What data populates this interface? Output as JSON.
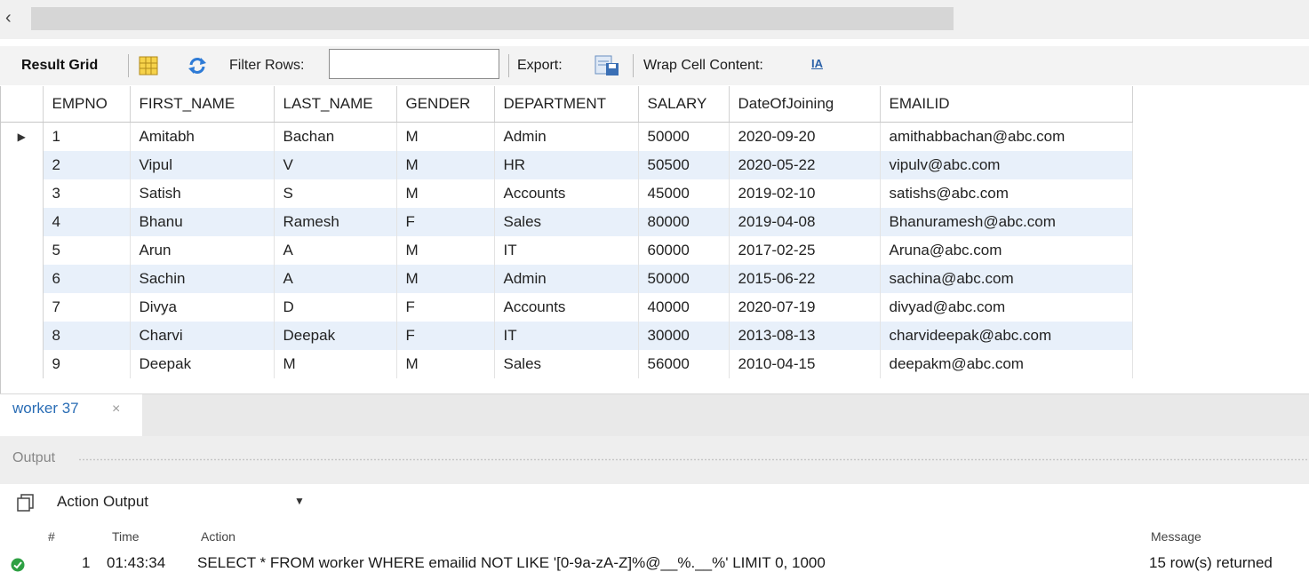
{
  "toolbar": {
    "result_grid": "Result Grid",
    "filter_label": "Filter Rows:",
    "filter_value": "",
    "export_label": "Export:",
    "wrap_label": "Wrap Cell Content:",
    "wrap_icon_text": "IA"
  },
  "grid": {
    "columns": [
      "EMPNO",
      "FIRST_NAME",
      "LAST_NAME",
      "GENDER",
      "DEPARTMENT",
      "SALARY",
      "DateOfJoining",
      "EMAILID"
    ],
    "selected_row_marker": "▶",
    "rows": [
      [
        "1",
        "Amitabh",
        "Bachan",
        "M",
        "Admin",
        "50000",
        "2020-09-20",
        "amithabbachan@abc.com"
      ],
      [
        "2",
        "Vipul",
        "V",
        "M",
        "HR",
        "50500",
        "2020-05-22",
        "vipulv@abc.com"
      ],
      [
        "3",
        "Satish",
        "S",
        "M",
        "Accounts",
        "45000",
        "2019-02-10",
        "satishs@abc.com"
      ],
      [
        "4",
        "Bhanu",
        "Ramesh",
        "F",
        "Sales",
        "80000",
        "2019-04-08",
        "Bhanuramesh@abc.com"
      ],
      [
        "5",
        "Arun",
        "A",
        "M",
        "IT",
        "60000",
        "2017-02-25",
        "Aruna@abc.com"
      ],
      [
        "6",
        "Sachin",
        "A",
        "M",
        "Admin",
        "50000",
        "2015-06-22",
        "sachina@abc.com"
      ],
      [
        "7",
        "Divya",
        "D",
        "F",
        "Accounts",
        "40000",
        "2020-07-19",
        "divyad@abc.com"
      ],
      [
        "8",
        "Charvi",
        "Deepak",
        "F",
        "IT",
        "30000",
        "2013-08-13",
        "charvideepak@abc.com"
      ],
      [
        "9",
        "Deepak",
        "M",
        "M",
        "Sales",
        "56000",
        "2010-04-15",
        "deepakm@abc.com"
      ]
    ]
  },
  "tab": {
    "label": "worker 37",
    "close": "×"
  },
  "output": {
    "title": "Output",
    "selector": "Action Output",
    "headers": {
      "num": "#",
      "time": "Time",
      "action": "Action",
      "message": "Message"
    },
    "log": {
      "num": "1",
      "time": "01:43:34",
      "action": "SELECT * FROM worker WHERE emailid NOT LIKE '[0-9a-zA-Z]%@__%.__%' LIMIT 0, 1000",
      "message": "15 row(s) returned"
    }
  },
  "colors": {
    "alt_row": "#e8f0fa",
    "tab_text": "#2a6db5",
    "ok": "#2ea043"
  }
}
